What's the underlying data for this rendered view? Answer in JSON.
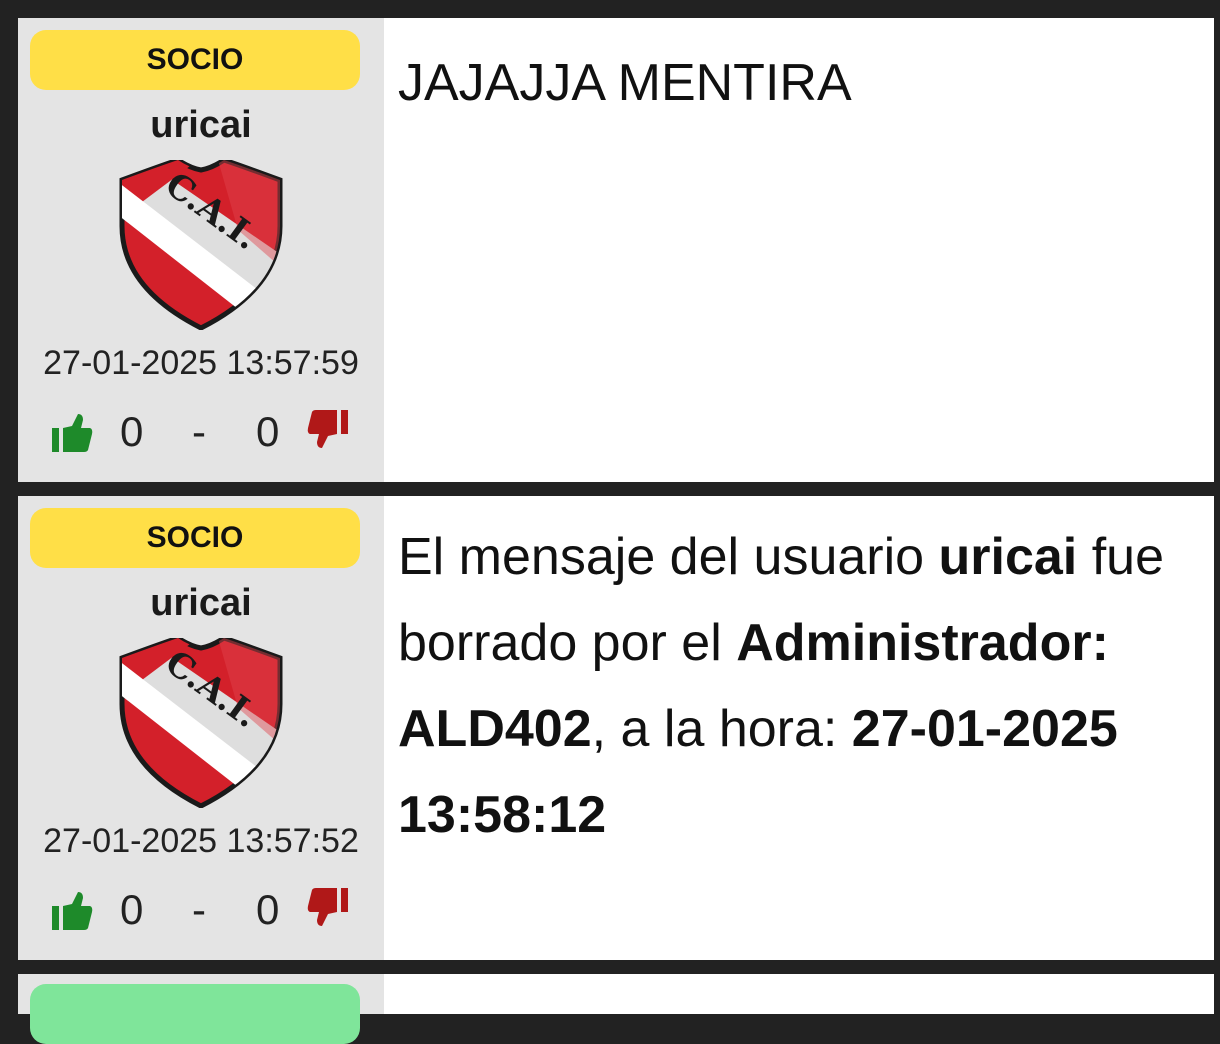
{
  "posts": [
    {
      "role": "SOCIO",
      "username": "uricai",
      "timestamp": "27-01-2025 13:57:59",
      "likes": "0",
      "separator": "-",
      "dislikes": "0",
      "message": "JAJAJJA MENTIRA"
    },
    {
      "role": "SOCIO",
      "username": "uricai",
      "timestamp": "27-01-2025 13:57:52",
      "likes": "0",
      "separator": "-",
      "dislikes": "0",
      "deleted": {
        "prefix": "El mensaje del usuario ",
        "user": "uricai",
        "middle": " fue borrado por el ",
        "admin": "Administrador: ALD402",
        "suffix": ", a la hora: ",
        "time": "27-01-2025 13:58:12"
      }
    }
  ],
  "crest_letters": "C.A.I.",
  "colors": {
    "background": "#222222",
    "sidebar": "#e4e4e4",
    "role_badge": "#ffdf47",
    "role_badge_next": "#7fe59a",
    "like": "#1e8a2a",
    "dislike": "#b01818",
    "crest_red": "#d3202a"
  },
  "icons": {
    "like": "thumbs-up-icon",
    "dislike": "thumbs-down-icon",
    "avatar": "club-crest"
  }
}
